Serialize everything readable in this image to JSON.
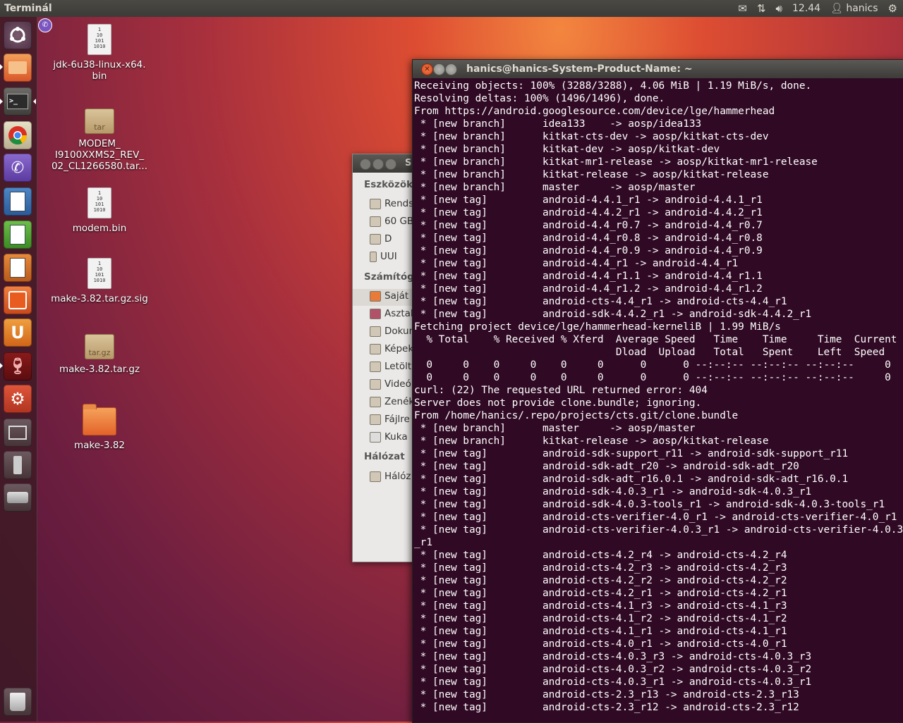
{
  "top_panel": {
    "title": "Terminál",
    "clock": "12.44",
    "user": "hanics",
    "icons": [
      "mail-icon",
      "network-icon",
      "volume-icon",
      "user-icon",
      "gear-icon"
    ]
  },
  "launcher": {
    "items": [
      "dash-home",
      "files",
      "terminal",
      "chrome",
      "viber",
      "writer",
      "calc",
      "impress",
      "software-center",
      "ubuntu-one",
      "wine",
      "system-settings",
      "workspaces",
      "usb-drive",
      "disk-drive",
      "trash"
    ]
  },
  "desktop": {
    "icons": [
      {
        "label": "jdk-6u38-linux-x64.\nbin",
        "type": "binary"
      },
      {
        "label": "MODEM_\nI9100XXMS2_REV_\n02_CL1266580.tar...",
        "type": "tar",
        "badge": "tar"
      },
      {
        "label": "modem.bin",
        "type": "binary"
      },
      {
        "label": "make-3.82.tar.gz.sig",
        "type": "binary"
      },
      {
        "label": "make-3.82.tar.gz",
        "type": "tar",
        "badge": "tar.gz"
      },
      {
        "label": "make-3.82",
        "type": "folder"
      }
    ],
    "binary_glyph": "1\n10\n101\n1010"
  },
  "file_manager": {
    "title": "S",
    "sections": {
      "devices": "Eszközök",
      "computer": "Számítóg",
      "network": "Hálózat"
    },
    "device_items": [
      "Rends",
      "60 GB",
      "D",
      "UUI"
    ],
    "computer_items": [
      "Saját",
      "Asztal",
      "Dokun",
      "Képek",
      "Letölt",
      "Videó",
      "Zenék",
      "Fájlre",
      "Kuka"
    ],
    "network_items": [
      "Hálóz"
    ]
  },
  "terminal": {
    "title": "hanics@hanics-System-Product-Name: ~",
    "lines": [
      "Receiving objects: 100% (3288/3288), 4.06 MiB | 1.19 MiB/s, done.",
      "Resolving deltas: 100% (1496/1496), done.",
      "From https://android.googlesource.com/device/lge/hammerhead",
      " * [new branch]      idea133    -> aosp/idea133",
      " * [new branch]      kitkat-cts-dev -> aosp/kitkat-cts-dev",
      " * [new branch]      kitkat-dev -> aosp/kitkat-dev",
      " * [new branch]      kitkat-mr1-release -> aosp/kitkat-mr1-release",
      " * [new branch]      kitkat-release -> aosp/kitkat-release",
      " * [new branch]      master     -> aosp/master",
      " * [new tag]         android-4.4.1_r1 -> android-4.4.1_r1",
      " * [new tag]         android-4.4.2_r1 -> android-4.4.2_r1",
      " * [new tag]         android-4.4_r0.7 -> android-4.4_r0.7",
      " * [new tag]         android-4.4_r0.8 -> android-4.4_r0.8",
      " * [new tag]         android-4.4_r0.9 -> android-4.4_r0.9",
      " * [new tag]         android-4.4_r1 -> android-4.4_r1",
      " * [new tag]         android-4.4_r1.1 -> android-4.4_r1.1",
      " * [new tag]         android-4.4_r1.2 -> android-4.4_r1.2",
      " * [new tag]         android-cts-4.4_r1 -> android-cts-4.4_r1",
      " * [new tag]         android-sdk-4.4.2_r1 -> android-sdk-4.4.2_r1",
      "Fetching project device/lge/hammerhead-kerneliB | 1.99 MiB/s",
      "  % Total    % Received % Xferd  Average Speed   Time    Time     Time  Current",
      "                                 Dload  Upload   Total   Spent    Left  Speed",
      "  0     0    0     0    0     0      0      0 --:--:-- --:--:-- --:--:--     0",
      "  0     0    0     0    0     0      0      0 --:--:-- --:--:-- --:--:--     0",
      "curl: (22) The requested URL returned error: 404",
      "Server does not provide clone.bundle; ignoring.",
      "From /home/hanics/.repo/projects/cts.git/clone.bundle",
      " * [new branch]      master     -> aosp/master",
      " * [new branch]      kitkat-release -> aosp/kitkat-release",
      " * [new tag]         android-sdk-support_r11 -> android-sdk-support_r11",
      " * [new tag]         android-sdk-adt_r20 -> android-sdk-adt_r20",
      " * [new tag]         android-sdk-adt_r16.0.1 -> android-sdk-adt_r16.0.1",
      " * [new tag]         android-sdk-4.0.3_r1 -> android-sdk-4.0.3_r1",
      " * [new tag]         android-sdk-4.0.3-tools_r1 -> android-sdk-4.0.3-tools_r1",
      " * [new tag]         android-cts-verifier-4.0_r1 -> android-cts-verifier-4.0_r1",
      " * [new tag]         android-cts-verifier-4.0.3_r1 -> android-cts-verifier-4.0.3",
      "_r1",
      " * [new tag]         android-cts-4.2_r4 -> android-cts-4.2_r4",
      " * [new tag]         android-cts-4.2_r3 -> android-cts-4.2_r3",
      " * [new tag]         android-cts-4.2_r2 -> android-cts-4.2_r2",
      " * [new tag]         android-cts-4.2_r1 -> android-cts-4.2_r1",
      " * [new tag]         android-cts-4.1_r3 -> android-cts-4.1_r3",
      " * [new tag]         android-cts-4.1_r2 -> android-cts-4.1_r2",
      " * [new tag]         android-cts-4.1_r1 -> android-cts-4.1_r1",
      " * [new tag]         android-cts-4.0_r1 -> android-cts-4.0_r1",
      " * [new tag]         android-cts-4.0.3_r3 -> android-cts-4.0.3_r3",
      " * [new tag]         android-cts-4.0.3_r2 -> android-cts-4.0.3_r2",
      " * [new tag]         android-cts-4.0.3_r1 -> android-cts-4.0.3_r1",
      " * [new tag]         android-cts-2.3_r13 -> android-cts-2.3_r13",
      " * [new tag]         android-cts-2.3_r12 -> android-cts-2.3_r12"
    ]
  },
  "colors": {
    "terminal_bg": "#300a24",
    "panel_bg": "#3c3b37",
    "close_button": "#e0592a"
  }
}
